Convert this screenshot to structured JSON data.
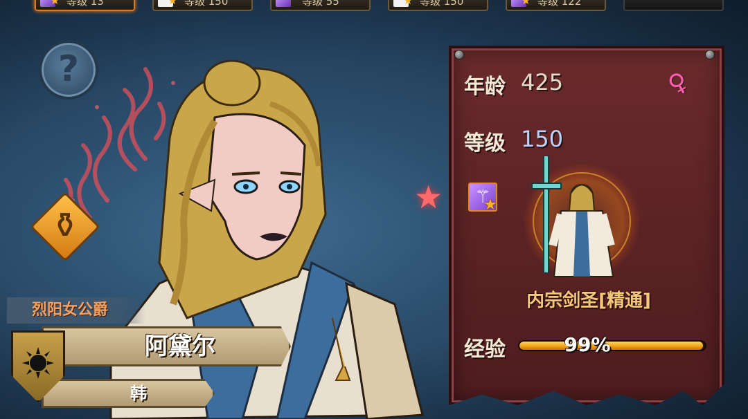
{
  "top_slots": [
    {
      "label": "等级 13",
      "icon": "purple-staff-icon",
      "active": true
    },
    {
      "label": "等级 150",
      "icon": "white-card-icon",
      "active": false
    },
    {
      "label": "等级 55",
      "icon": "purple-card-icon",
      "active": false
    },
    {
      "label": "等级 150",
      "icon": "white-card-icon",
      "active": false
    },
    {
      "label": "等级 122",
      "icon": "purple-staff-icon",
      "active": false
    },
    {
      "label": "",
      "icon": "empty-slot",
      "active": false
    }
  ],
  "character": {
    "title": "烈阳女公爵",
    "name": "阿黛尔",
    "family": "韩",
    "crest": "black-sun-crest"
  },
  "panel": {
    "age_label": "年龄",
    "age_value": "425",
    "gender": "female",
    "gender_symbol": "♀",
    "level_label": "等级",
    "level_value": "150",
    "class_icon": "staff-icon",
    "class_name": "内宗剑圣[精通]",
    "exp_label": "经验",
    "exp_text": "99%",
    "exp_value": 0.99
  },
  "icons": {
    "help": "?",
    "potion": "potion-icon",
    "star": "★",
    "staff": "⚚"
  },
  "colors": {
    "panel_bg": "#5a2124",
    "gold": "#f6c878",
    "exp_fill": "#f2a418",
    "gender_pink": "#ff5fb0"
  }
}
